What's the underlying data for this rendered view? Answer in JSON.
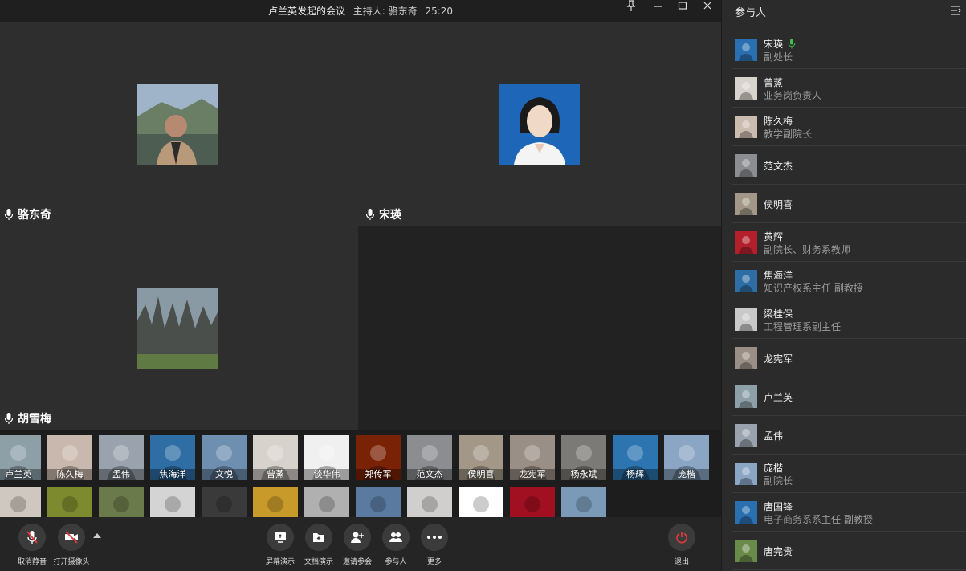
{
  "titlebar": {
    "title": "卢兰英发起的会议",
    "host": "主持人: 骆东奇",
    "time": "25:20",
    "icons": [
      "pin-icon",
      "minimize-icon",
      "maximize-icon",
      "close-icon"
    ]
  },
  "video": {
    "tiles": [
      {
        "name": "骆东奇",
        "avatar": "portrait-mountain"
      },
      {
        "name": "宋瑛",
        "avatar": "portrait-blue"
      },
      {
        "name": "胡雪梅",
        "avatar": "stone-forest"
      },
      {
        "name": "",
        "avatar": ""
      }
    ]
  },
  "thumbs": {
    "row1": [
      {
        "label": "卢兰英",
        "bg": "#8da0a8"
      },
      {
        "label": "陈久梅",
        "bg": "#c9b8ad"
      },
      {
        "label": "孟伟",
        "bg": "#9aa3ad"
      },
      {
        "label": "焦海洋",
        "bg": "#2f6ea5"
      },
      {
        "label": "文悦",
        "bg": "#6f8fb0"
      },
      {
        "label": "曾蒸",
        "bg": "#d7d2cc"
      },
      {
        "label": "谈华伟",
        "bg": "#f0f0f0"
      },
      {
        "label": "郑传军",
        "bg": "#7a2206"
      },
      {
        "label": "范文杰",
        "bg": "#8b8d90"
      },
      {
        "label": "侯明喜",
        "bg": "#a39888"
      },
      {
        "label": "龙宪军",
        "bg": "#9a8f86"
      },
      {
        "label": "杨永斌",
        "bg": "#7c7a76"
      },
      {
        "label": "杨辉",
        "bg": "#2d75b0"
      },
      {
        "label": "庞楷",
        "bg": "#8aa6c4"
      }
    ],
    "row2": [
      {
        "label": "",
        "bg": "#cfc8c0"
      },
      {
        "label": "",
        "bg": "#7e8a2e"
      },
      {
        "label": "",
        "bg": "#6a7a4a"
      },
      {
        "label": "",
        "bg": "#d4d4d4"
      },
      {
        "label": "",
        "bg": "#3a3a3a"
      },
      {
        "label": "",
        "bg": "#c89a2a"
      },
      {
        "label": "",
        "bg": "#b0b0b0"
      },
      {
        "label": "",
        "bg": "#5a7aa0"
      },
      {
        "label": "",
        "bg": "#d0cfcd"
      },
      {
        "label": "",
        "bg": "#ffffff"
      },
      {
        "label": "",
        "bg": "#a01020"
      },
      {
        "label": "",
        "bg": "#7a9ab8"
      }
    ]
  },
  "toolbar": {
    "unmute": "取消静音",
    "camera": "打开摄像头",
    "screen": "屏幕演示",
    "doc": "文档演示",
    "invite": "邀请参会",
    "participants": "参与人",
    "more": "更多",
    "leave": "退出"
  },
  "panel": {
    "title": "参与人",
    "items": [
      {
        "name": "宋瑛",
        "role": "副处长",
        "speaking": true,
        "bg": "#2a6fb0"
      },
      {
        "name": "曾蒸",
        "role": "业务岗负责人",
        "bg": "#d9d3cd"
      },
      {
        "name": "陈久梅",
        "role": "教学副院长",
        "bg": "#cbbcb0"
      },
      {
        "name": "范文杰",
        "role": "",
        "bg": "#8b8d90"
      },
      {
        "name": "侯明喜",
        "role": "",
        "bg": "#a39888"
      },
      {
        "name": "黄辉",
        "role": "副院长、财务系教师",
        "bg": "#b3202c"
      },
      {
        "name": "焦海洋",
        "role": "知识产权系主任 副教授",
        "bg": "#2f6ea5"
      },
      {
        "name": "梁桂保",
        "role": "工程管理系副主任",
        "bg": "#c9c9c9"
      },
      {
        "name": "龙宪军",
        "role": "",
        "bg": "#9a8f86"
      },
      {
        "name": "卢兰英",
        "role": "",
        "bg": "#8da0a8"
      },
      {
        "name": "孟伟",
        "role": "",
        "bg": "#9aa3ad"
      },
      {
        "name": "庞楷",
        "role": "副院长",
        "bg": "#8aa6c4"
      },
      {
        "name": "唐国锋",
        "role": "电子商务系系主任 副教授",
        "bg": "#2a6fb0"
      },
      {
        "name": "唐完贵",
        "role": "",
        "bg": "#6a8a4a"
      }
    ]
  }
}
